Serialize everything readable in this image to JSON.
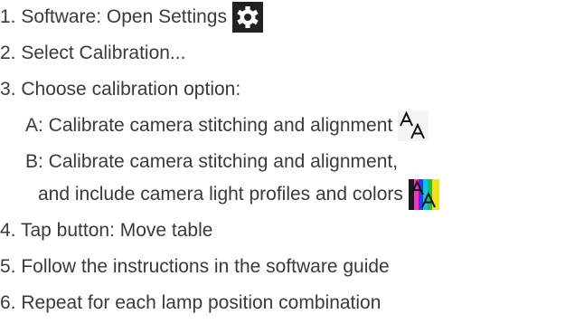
{
  "steps": [
    {
      "text": "1. Software: Open Settings",
      "icon": "gear-icon"
    },
    {
      "text": "2. Select Calibration..."
    },
    {
      "text": "3. Choose calibration option:"
    },
    {
      "text": "A: Calibrate camera stitching and alignment",
      "icon": "calibrate-alignment-icon"
    },
    {
      "text": "B: Calibrate camera stitching and alignment,"
    },
    {
      "text": "and include camera light profiles and colors",
      "icon": "calibrate-color-icon"
    },
    {
      "text": "4. Tap button: Move table"
    },
    {
      "text": "5. Follow the instructions in the software guide"
    },
    {
      "text": "6. Repeat for each lamp position combination"
    }
  ],
  "colors": {
    "text": "#3a3a3a",
    "gear_background": "#222222",
    "alignment_glyph": "#111111"
  }
}
